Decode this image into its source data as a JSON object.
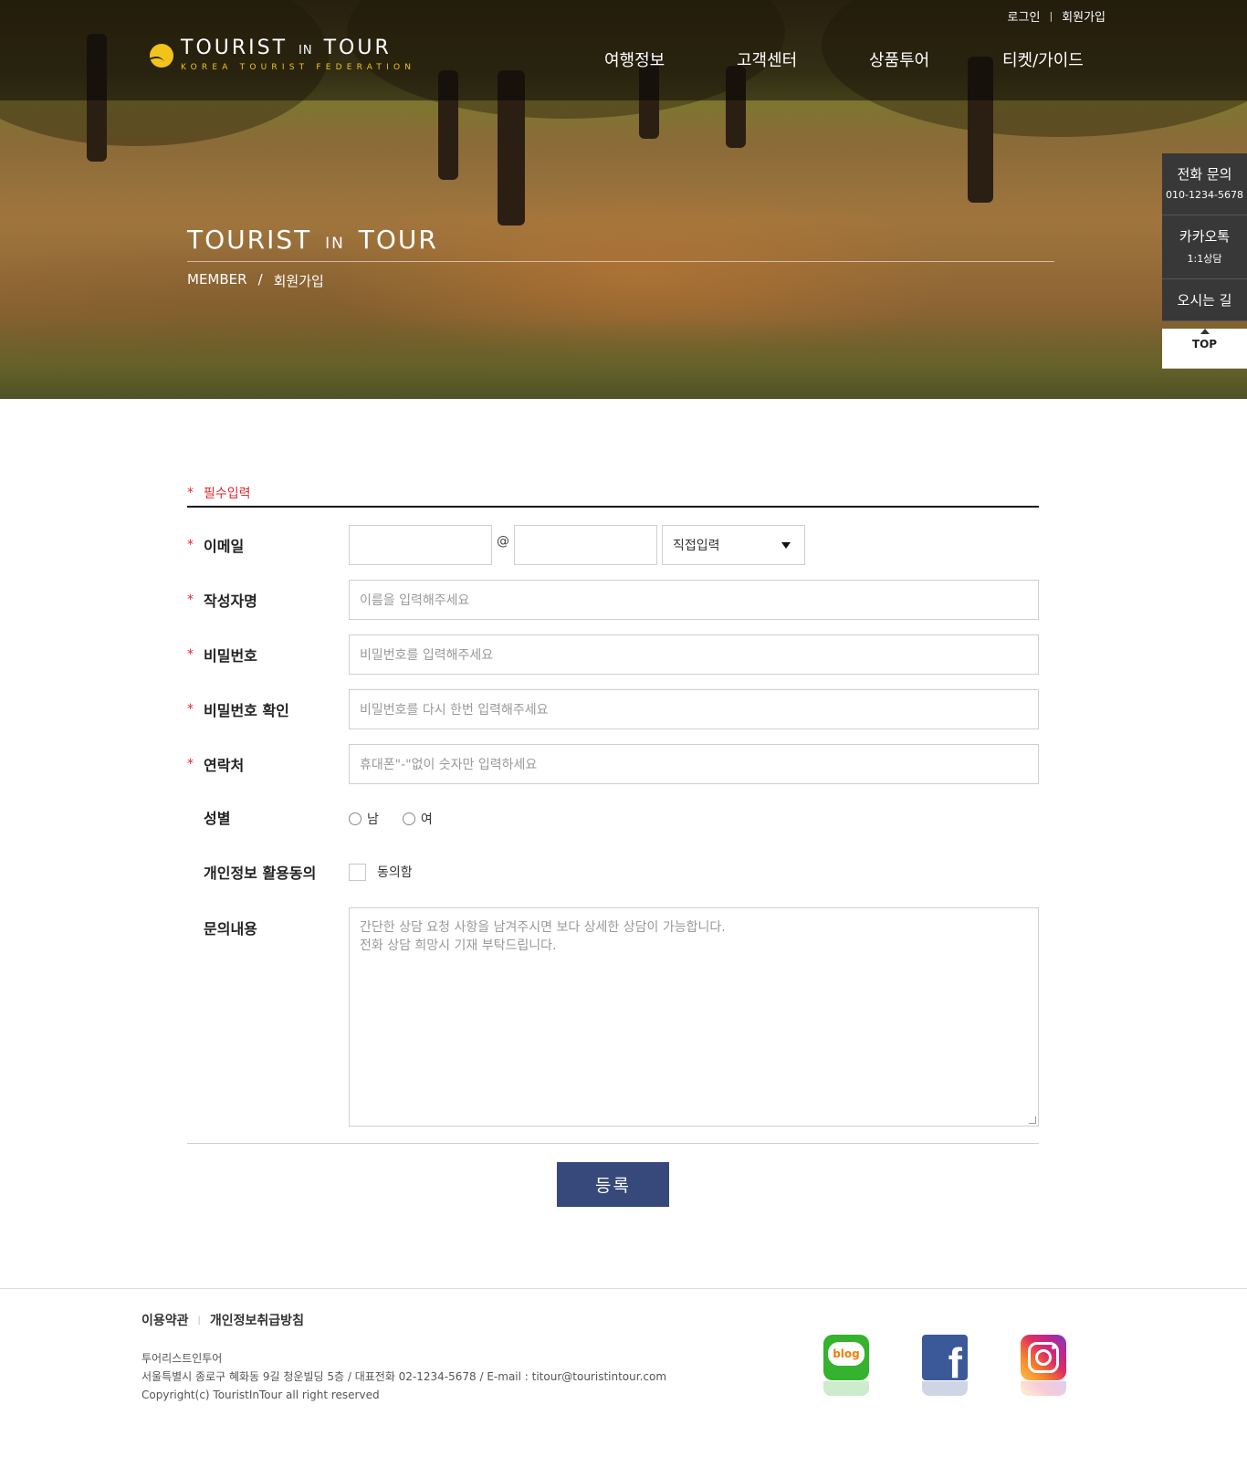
{
  "header": {
    "logo": {
      "title_a": "TOURIST",
      "title_in": "IN",
      "title_b": "TOUR",
      "subtitle": "KOREA TOURIST FEDERATION"
    },
    "util": {
      "login": "로그인",
      "separator": "|",
      "signup": "회원가입"
    },
    "nav": [
      "여행정보",
      "고객센터",
      "상품투어",
      "티켓/가이드"
    ]
  },
  "hero": {
    "title_a": "TOURIST",
    "title_in": "IN",
    "title_b": "TOUR",
    "breadcrumb": {
      "section": "MEMBER",
      "slash": "/",
      "page": "회원가입"
    }
  },
  "quick_menu": {
    "phone": {
      "label": "전화 문의",
      "number": "010-1234-5678"
    },
    "kakao": {
      "label": "카카오톡",
      "sub": "1:1상담"
    },
    "directions": {
      "label": "오시는 길"
    },
    "top": {
      "label": "TOP"
    }
  },
  "form": {
    "required_star": "*",
    "required_note": "필수입력",
    "email": {
      "label": "이메일",
      "at": "@",
      "domain_select": "직접입력"
    },
    "name": {
      "label": "작성자명",
      "placeholder": "이름을 입력해주세요"
    },
    "password": {
      "label": "비밀번호",
      "placeholder": "비밀번호를 입력해주세요"
    },
    "password_confirm": {
      "label": "비밀번호 확인",
      "placeholder": "비밀번호를 다시 한번 입력해주세요"
    },
    "phone": {
      "label": "연락처",
      "placeholder": "휴대폰\"-\"없이 숫자만 입력하세요"
    },
    "gender": {
      "label": "성별",
      "male": "남",
      "female": "여"
    },
    "privacy": {
      "label": "개인정보 활용동의",
      "agree": "동의함"
    },
    "inquiry": {
      "label": "문의내용",
      "placeholder_line1": "간단한 상담 요청 사항을 남겨주시면 보다 상세한 상담이 가능합니다.",
      "placeholder_line2": "전화 상담 희망시 기재 부탁드립니다."
    },
    "submit": "등록"
  },
  "footer": {
    "terms": "이용약관",
    "separator": "|",
    "privacy_policy": "개인정보취급방침",
    "company": "투어리스트인투어",
    "address": "서울특별시 종로구 혜화동 9길 청운빌딩 5층 / 대표전화 02-1234-5678 / E-mail : titour@touristintour.com",
    "copyright": "Copyright(c) TouristInTour all right reserved",
    "sns": {
      "blog": "blog"
    }
  },
  "colors": {
    "accent_navy": "#36497a",
    "required_red": "#e0282e",
    "logo_yellow": "#f2c319"
  }
}
